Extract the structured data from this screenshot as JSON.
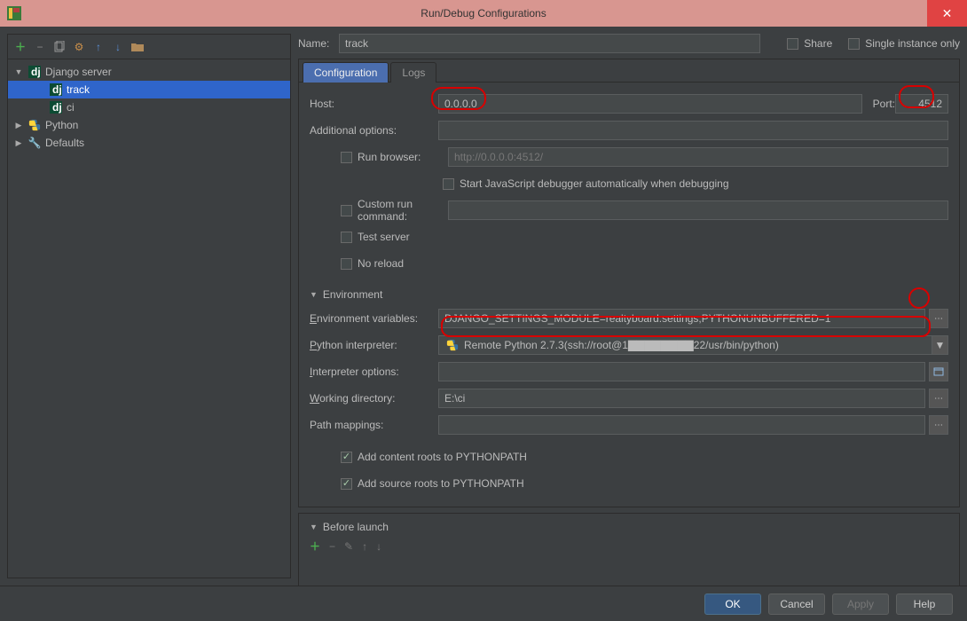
{
  "window": {
    "title": "Run/Debug Configurations"
  },
  "toolbar": {
    "add": "+",
    "remove": "−"
  },
  "tree": {
    "django_server": "Django server",
    "track": "track",
    "ci": "ci",
    "python": "Python",
    "defaults": "Defaults"
  },
  "form": {
    "name_label": "Name:",
    "name_value": "track",
    "share": "Share",
    "single_instance": "Single instance only",
    "tabs": {
      "configuration": "Configuration",
      "logs": "Logs"
    },
    "host_label": "Host:",
    "host_value": "0.0.0.0",
    "port_label": "Port:",
    "port_value": "4512",
    "addl_label": "Additional options:",
    "addl_value": "",
    "run_browser": "Run browser:",
    "browser_placeholder": "http://0.0.0.0:4512/",
    "js_debugger": "Start JavaScript debugger automatically when debugging",
    "custom_run": "Custom run command:",
    "custom_run_value": "",
    "test_server": "Test server",
    "no_reload": "No reload",
    "env_header": "Environment",
    "env_vars_label": "Environment variables:",
    "env_vars_value": "DJANGO_SETTINGS_MODULE=realtyboard.settings;PYTHONUNBUFFERED=1",
    "interpreter_label": "Python interpreter:",
    "interpreter_value": "Remote Python 2.7.3(ssh://root@1▇▇▇▇▇▇▇▇22/usr/bin/python)",
    "interp_opts_label": "Interpreter options:",
    "interp_opts_value": "",
    "workdir_label": "Working directory:",
    "workdir_value": "E:\\ci",
    "path_map_label": "Path mappings:",
    "path_map_value": "",
    "add_content_roots": "Add content roots to PYTHONPATH",
    "add_source_roots": "Add source roots to PYTHONPATH",
    "before_launch": "Before launch"
  },
  "buttons": {
    "ok": "OK",
    "cancel": "Cancel",
    "apply": "Apply",
    "help": "Help"
  }
}
